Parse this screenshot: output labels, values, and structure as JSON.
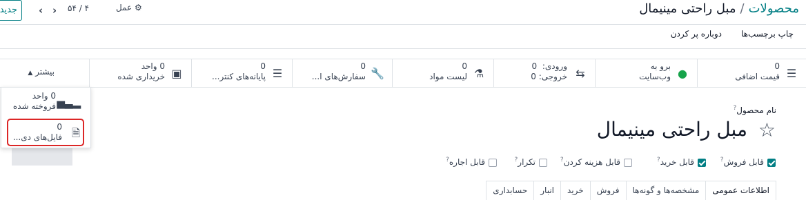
{
  "topbar": {
    "new_label": "جدید",
    "pager": "۵۴ / ۴",
    "action_label": "عمل",
    "breadcrumb_parent": "محصولات",
    "breadcrumb_sep": "/",
    "breadcrumb_current": "مبل راحتی مینیمال"
  },
  "toolbar": {
    "print_labels": "چاپ برچسب‌ها",
    "replenish": "دوباره پر کردن"
  },
  "smart_buttons": {
    "extra_price": {
      "count": "0",
      "label": "قیمت اضافی",
      "icon": "list-icon"
    },
    "website": {
      "line1": "برو به",
      "line2": "وب‌سایت",
      "icon": "globe-icon"
    },
    "in_out": {
      "in_label": "ورودی:",
      "in_value": "0",
      "out_label": "خروجی:",
      "out_value": "0",
      "icon": "exchange-icon"
    },
    "bom": {
      "count": "0",
      "label": "لیست مواد",
      "icon": "flask-icon"
    },
    "repairs": {
      "count": "0",
      "label": "سفارش‌های ا...",
      "icon": "wrench-icon"
    },
    "pos": {
      "count": "0",
      "label": "پایانه‌های کنتر...",
      "icon": "list-icon"
    },
    "purchased": {
      "line1": "0 واحد",
      "line2": "خریداری شده",
      "icon": "credit-card-icon"
    },
    "more": {
      "label": "بیشتر"
    }
  },
  "dropdown": {
    "sold": {
      "line1": "0 واحد",
      "line2": "فروخته شده",
      "icon": "bar-chart-icon"
    },
    "files": {
      "count": "0",
      "label": "فایل‌های دی...",
      "icon": "file-icon"
    }
  },
  "form": {
    "name_label": "نام محصول",
    "help_mark": "?",
    "title": "مبل راحتی مینیمال",
    "checkboxes": [
      {
        "label": "قابل فروش",
        "checked": true
      },
      {
        "label": "قابل خرید",
        "checked": true
      },
      {
        "label": "قابل هزینه کردن",
        "checked": false
      },
      {
        "label": "تکرار",
        "checked": false
      },
      {
        "label": "قابل اجاره",
        "checked": false
      }
    ]
  },
  "tabs": [
    "اطلاعات عمومی",
    "مشخصه‌ها و گونه‌ها",
    "فروش",
    "خرید",
    "انبار",
    "حسابداری"
  ],
  "colors": {
    "accent": "#017e84",
    "highlight": "#dc2626",
    "globe": "#16a34a"
  }
}
